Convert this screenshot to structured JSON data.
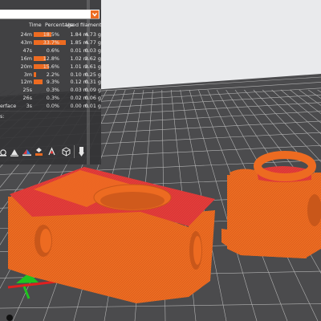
{
  "title_bar_color": "#ed6b21",
  "legend": {
    "columns": {
      "time": "Time",
      "percentage": "Percentage",
      "used_filament": "Used filament"
    },
    "rows": [
      {
        "feature": "",
        "time": "24m",
        "percentage": "18.5%",
        "length": "1.84 m",
        "weight": "4.73 g",
        "share": 0.185
      },
      {
        "feature": "",
        "time": "43m",
        "percentage": "33.7%",
        "length": "1.85 m",
        "weight": "4.77 g",
        "share": 0.337
      },
      {
        "feature": "",
        "time": "47s",
        "percentage": "0.6%",
        "length": "0.01 m",
        "weight": "0.03 g",
        "share": 0.006
      },
      {
        "feature": "",
        "time": "16m",
        "percentage": "12.8%",
        "length": "1.02 m",
        "weight": "2.62 g",
        "share": 0.128
      },
      {
        "feature": "",
        "time": "20m",
        "percentage": "15.6%",
        "length": "1.01 m",
        "weight": "2.61 g",
        "share": 0.156
      },
      {
        "feature": "",
        "time": "3m",
        "percentage": "2.2%",
        "length": "0.10 m",
        "weight": "0.25 g",
        "share": 0.022
      },
      {
        "feature": "",
        "time": "12m",
        "percentage": "9.3%",
        "length": "0.12 m",
        "weight": "0.31 g",
        "share": 0.093
      },
      {
        "feature": "",
        "time": "25s",
        "percentage": "0.3%",
        "length": "0.03 m",
        "weight": "0.09 g",
        "share": 0.003
      },
      {
        "feature": "",
        "time": "26s",
        "percentage": "0.3%",
        "length": "0.02 m",
        "weight": "0.06 g",
        "share": 0.003
      },
      {
        "feature": "erface",
        "time": "3s",
        "percentage": "0.0%",
        "length": "0.00 m",
        "weight": "0.01 g",
        "share": 0.0
      }
    ],
    "footer_label": "s:"
  },
  "toolbar": {
    "tools": [
      "brim-icon",
      "wipe-icon",
      "color-change-icon",
      "pause-icon",
      "custom-gcode-icon",
      "shells-icon",
      "tool-marker-icon"
    ]
  },
  "scene": {
    "bed_color": "#4d4d4d",
    "grid_color": "#a9a9a9",
    "object_color": "#ed6b21",
    "top_face_color": "#e53a3a",
    "axis_colors": {
      "x": "#e61e1e",
      "y": "#1ec81e",
      "z": "#1e1ee6"
    }
  }
}
